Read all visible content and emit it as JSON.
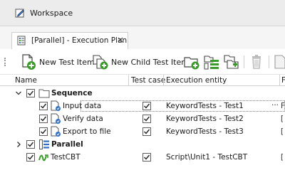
{
  "window": {
    "title": "Workspace"
  },
  "tab": {
    "label": "[Parallel] - Execution Plan",
    "close_glyph": "×"
  },
  "toolbar": {
    "new_test_item_label": "New Test Item",
    "new_child_test_item_label": "New Child Test Item"
  },
  "grid": {
    "columns": {
      "name": "Name",
      "test_case": "Test case",
      "execution_entity": "Execution entity",
      "extra": "F"
    },
    "rows": [
      {
        "name": "Sequence",
        "entity": "",
        "test_case": "",
        "edge": ""
      },
      {
        "name": "Input data",
        "entity": "KeywordTests - Test1",
        "test_case": "checked",
        "edge": "F",
        "dots": "···"
      },
      {
        "name": "Verify data",
        "entity": "KeywordTests - Test2",
        "test_case": "checked",
        "edge": "["
      },
      {
        "name": "Export to file",
        "entity": "KeywordTests - Test3",
        "test_case": "checked",
        "edge": "["
      },
      {
        "name": "Parallel",
        "entity": "",
        "test_case": "",
        "edge": ""
      },
      {
        "name": "TestCBT",
        "entity": "Script\\Unit1 - TestCBT",
        "test_case": "checked",
        "edge": "["
      }
    ]
  },
  "colors": {
    "accent_green": "#3a9a2a",
    "icon_blue": "#2f6fc4",
    "folder_gray": "#666666"
  },
  "icons": [
    "workspace-icon",
    "execution-plan-icon",
    "new-test-item-icon",
    "new-child-test-item-icon",
    "new-folder-icon",
    "new-group-icon",
    "new-subfolder-icon",
    "delete-icon"
  ]
}
